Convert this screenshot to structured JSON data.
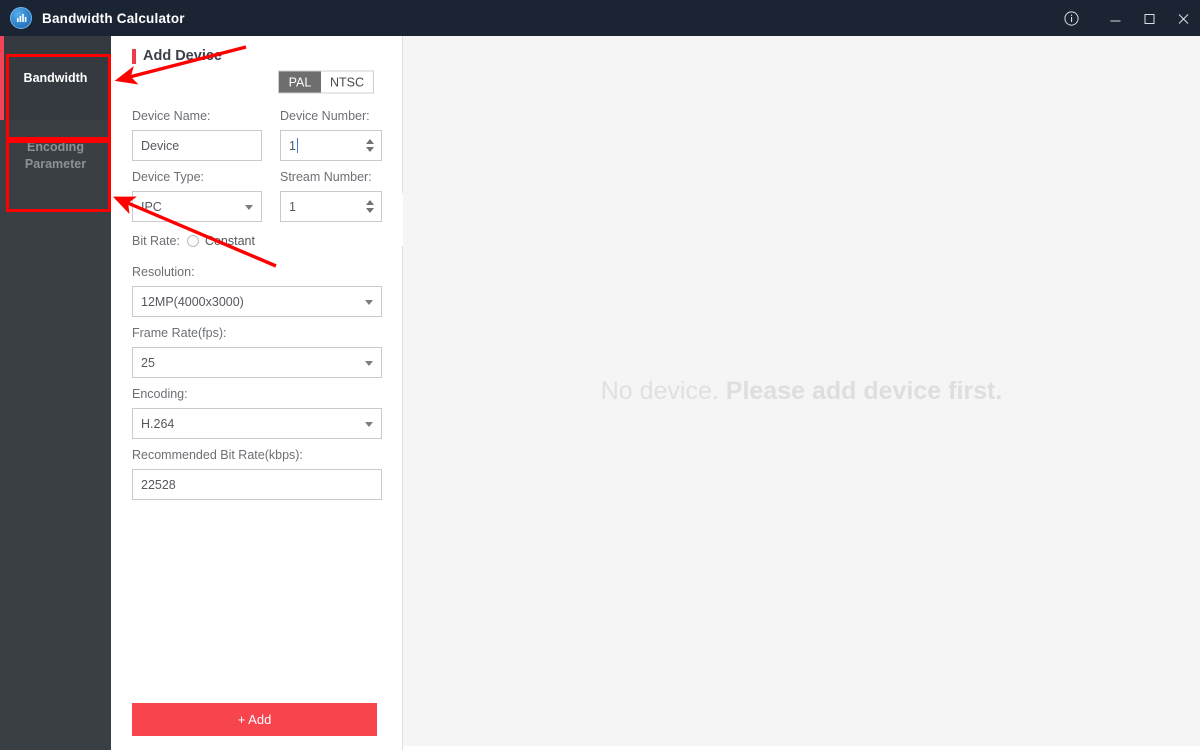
{
  "window": {
    "title": "Bandwidth Calculator",
    "logo_icon": "bandwidth-logo-icon",
    "controls": [
      {
        "name": "info-button",
        "icon": "info-circle-icon",
        "label": "ⓘ"
      },
      {
        "name": "minimize-button",
        "icon": "minimize-icon",
        "label": "—"
      },
      {
        "name": "maximize-button",
        "icon": "maximize-icon",
        "label": "□"
      },
      {
        "name": "close-button",
        "icon": "close-icon",
        "label": "✕"
      }
    ]
  },
  "sidebar": {
    "items": [
      {
        "label": "Bandwidth",
        "active": true
      },
      {
        "label": "Encoding Parameter",
        "active": false
      }
    ]
  },
  "panel": {
    "heading": "Add Device",
    "video_standard": {
      "options": [
        "PAL",
        "NTSC"
      ],
      "selected": "PAL"
    },
    "fields": {
      "device_name": {
        "label": "Device Name:",
        "value": "Device",
        "placeholder": "Device"
      },
      "device_number": {
        "label": "Device Number:",
        "value": "1"
      },
      "device_type": {
        "label": "Device Type:",
        "value": "IPC"
      },
      "stream_number": {
        "label": "Stream Number:",
        "value": "1"
      },
      "bit_rate": {
        "label": "Bit Rate:",
        "option": "Constant"
      },
      "resolution": {
        "label": "Resolution:",
        "value": "12MP(4000x3000)"
      },
      "frame_rate": {
        "label": "Frame Rate(fps):",
        "value": "25"
      },
      "encoding": {
        "label": "Encoding:",
        "value": "H.264"
      },
      "recommended_bit_rate": {
        "label": "Recommended Bit Rate(kbps):",
        "value": "22528"
      }
    },
    "add_button": "+ Add",
    "collapse_handle": "‹"
  },
  "content": {
    "empty_state_normal": "No device. ",
    "empty_state_bold": "Please add device first."
  },
  "colors": {
    "titlebar_bg": "#1b2433",
    "sidebar_bg": "#3a3f44",
    "accent_red": "#f2455a",
    "add_button": "#f8444c",
    "content_bg": "#f5f5f5",
    "annotation_red": "#ff0000"
  }
}
